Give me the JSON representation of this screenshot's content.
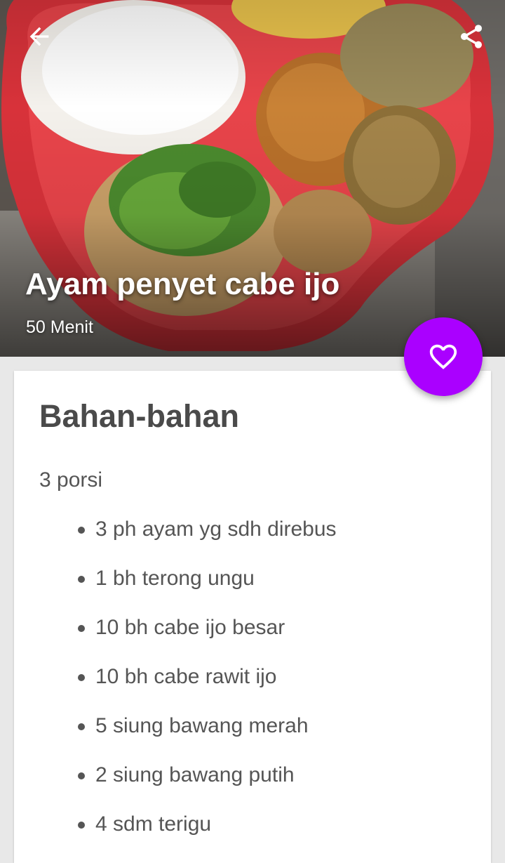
{
  "header": {
    "back_icon": "arrow-left-icon",
    "share_icon": "share-icon"
  },
  "recipe": {
    "title": "Ayam penyet cabe ijo",
    "cook_time": "50 Menit"
  },
  "favorite": {
    "icon": "heart-outline-icon",
    "color": "#aa00ff"
  },
  "ingredients_section": {
    "heading": "Bahan-bahan",
    "servings": "3 porsi",
    "items": [
      "3 ph ayam yg sdh direbus",
      "1 bh terong ungu",
      "10 bh cabe ijo besar",
      "10 bh cabe rawit ijo",
      "5 siung bawang merah",
      "2 siung bawang putih",
      "4 sdm terigu"
    ]
  }
}
